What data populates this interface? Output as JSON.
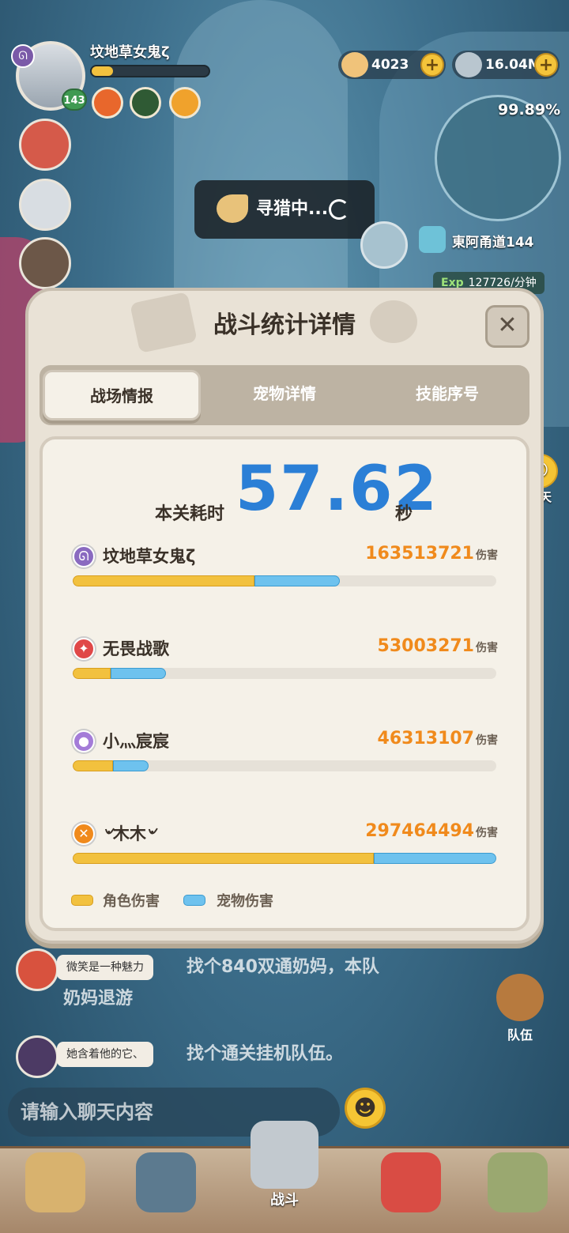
{
  "player": {
    "name": "坟地草女鬼ζ",
    "level": "143"
  },
  "currency": [
    {
      "value": "4023",
      "icon": "shell-icon"
    },
    {
      "value": "16.04M",
      "icon": "pearl-icon"
    }
  ],
  "minimap": {
    "progress": "99.89%",
    "location": "東阿甬道144",
    "exp_label": "Exp",
    "exp_rate": "127726/分钟"
  },
  "hunting": {
    "text": "寻猎中..."
  },
  "chat_float": {
    "label": "聊天"
  },
  "panel": {
    "title": "战斗统计详情",
    "tabs": [
      "战场情报",
      "宠物详情",
      "技能序号"
    ],
    "time_label": "本关耗时",
    "time_value": "57.62",
    "time_unit": "秒",
    "damage_unit": "伤害",
    "legend": {
      "role": "角色伤害",
      "pet": "宠物伤害"
    }
  },
  "chart_data": {
    "type": "bar",
    "stacked": true,
    "orientation": "horizontal",
    "categories": [
      "坟地草女鬼ζ",
      "无畏战歌",
      "小灬宸宸",
      "৺木木৺"
    ],
    "totals": [
      163513721,
      53003271,
      46313107,
      297464494
    ],
    "series": [
      {
        "name": "角色伤害",
        "color": "#f2c13e",
        "share": [
          0.43,
          0.09,
          0.095,
          0.71
        ]
      },
      {
        "name": "宠物伤害",
        "color": "#6ec2ee",
        "share": [
          0.2,
          0.13,
          0.085,
          0.29
        ]
      }
    ]
  },
  "players": [
    {
      "name": "坟地草女鬼ζ",
      "damage": "163513721",
      "icon_color": "#8a6ac0",
      "icon_glyph": "ᘏ"
    },
    {
      "name": "无畏战歌",
      "damage": "53003271",
      "icon_color": "#e04848",
      "icon_glyph": "✦"
    },
    {
      "name": "小灬宸宸",
      "damage": "46313107",
      "icon_color": "#a47cd8",
      "icon_glyph": "●"
    },
    {
      "name": "৺木木৺",
      "damage": "297464494",
      "icon_color": "#f08a1c",
      "icon_glyph": "✕"
    }
  ],
  "chat": [
    {
      "name": "微笑是一种魅力",
      "message": "找个840双通奶妈，本队",
      "message2": "奶妈退游"
    },
    {
      "name": "她含着他的它、",
      "message": "找个通关挂机队伍。"
    }
  ],
  "chat_input": {
    "placeholder": "请输入聊天内容"
  },
  "team_button": {
    "label": "队伍"
  },
  "nav": {
    "battle_label": "战斗"
  }
}
